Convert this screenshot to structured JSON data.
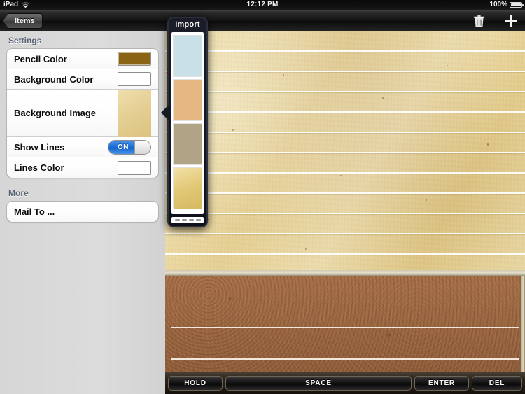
{
  "status_bar": {
    "device": "iPad",
    "wifi_icon": "wifi-icon",
    "time": "12:12 PM",
    "battery_percent": "100%",
    "battery_icon": "battery-full-icon"
  },
  "navbar": {
    "back_button": "Items",
    "trash_icon": "trash-icon",
    "add_icon": "plus-icon"
  },
  "sidebar": {
    "sections": [
      {
        "header": "Settings",
        "rows": [
          {
            "label": "Pencil Color",
            "control": "color-swatch",
            "value_color": "#8a6414"
          },
          {
            "label": "Background Color",
            "control": "color-swatch",
            "value_color": "#ffffff"
          },
          {
            "label": "Background Image",
            "control": "image-swatch",
            "value_color": "#e5cf94"
          },
          {
            "label": "Show Lines",
            "control": "toggle",
            "toggle_label": "ON",
            "toggle_state": "on"
          },
          {
            "label": "Lines Color",
            "control": "color-swatch",
            "value_color": "#ffffff"
          }
        ]
      },
      {
        "header": "More",
        "rows": [
          {
            "label": "Mail To ...",
            "control": "none"
          }
        ]
      }
    ]
  },
  "popover": {
    "title": "Import",
    "thumbnails": [
      {
        "name": "light-blue-paper",
        "color": "#c9e0e9"
      },
      {
        "name": "tan-paper",
        "color": "#e5b783"
      },
      {
        "name": "khaki-paper",
        "color": "#b1a386"
      },
      {
        "name": "gold-parchment-paper",
        "color": "#e2c877"
      }
    ],
    "pager_dashes": 4
  },
  "canvas": {
    "paper_background": "#e9d79b",
    "line_color": "#ffffff",
    "cork_background": "#9e6a45",
    "pushpin_icon": "red-pushpin-icon",
    "pushpin_color": "#d81f16"
  },
  "keybar": {
    "keys": [
      {
        "label": "HOLD"
      },
      {
        "label": "SPACE"
      },
      {
        "label": "ENTER"
      },
      {
        "label": "DEL"
      }
    ]
  }
}
